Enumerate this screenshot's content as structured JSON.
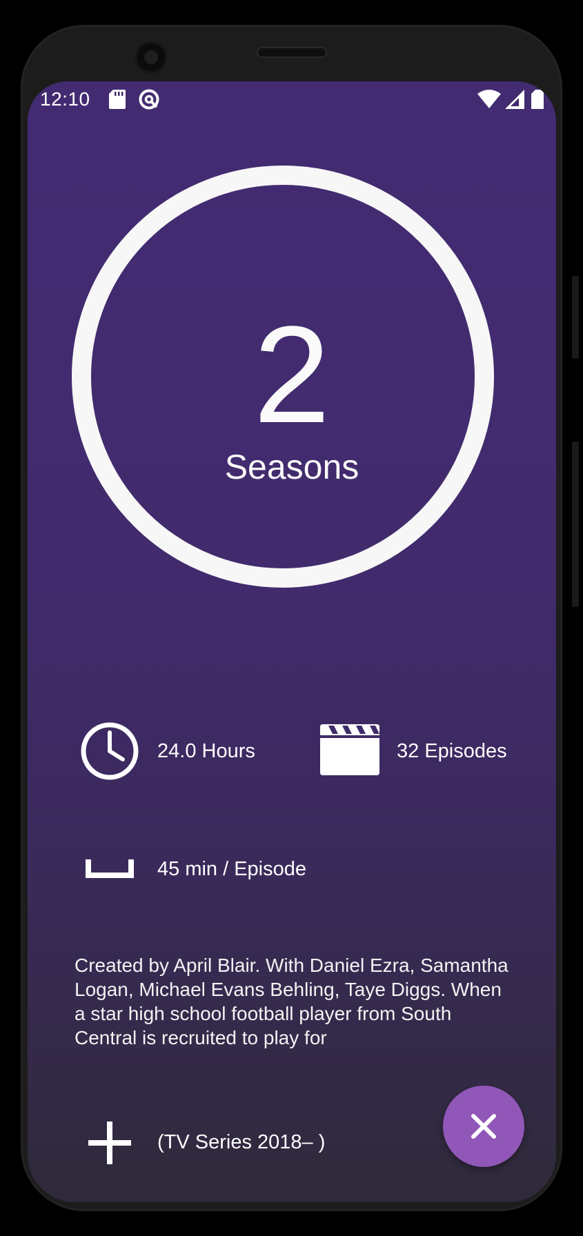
{
  "statusbar": {
    "time": "12:10",
    "icons": [
      "sd-card-icon",
      "vpn-icon",
      "wifi-icon",
      "signal-icon",
      "battery-icon"
    ]
  },
  "summary": {
    "season_count": "2",
    "season_label": "Seasons"
  },
  "stats": {
    "hours": "24.0 Hours",
    "episodes": "32 Episodes",
    "runtime": "45 min / Episode"
  },
  "description": "Created by April Blair.  With Daniel Ezra, Samantha Logan, Michael Evans Behling, Taye Diggs. When a star high school football player from South Central is recruited to play for",
  "series_info": "(TV Series 2018– )",
  "fab": {
    "icon": "close-icon"
  },
  "colors": {
    "background_top": "#432b72",
    "background_bottom": "#2f2a3a",
    "fab": "#9157b8",
    "ring": "#f7f7f7"
  }
}
